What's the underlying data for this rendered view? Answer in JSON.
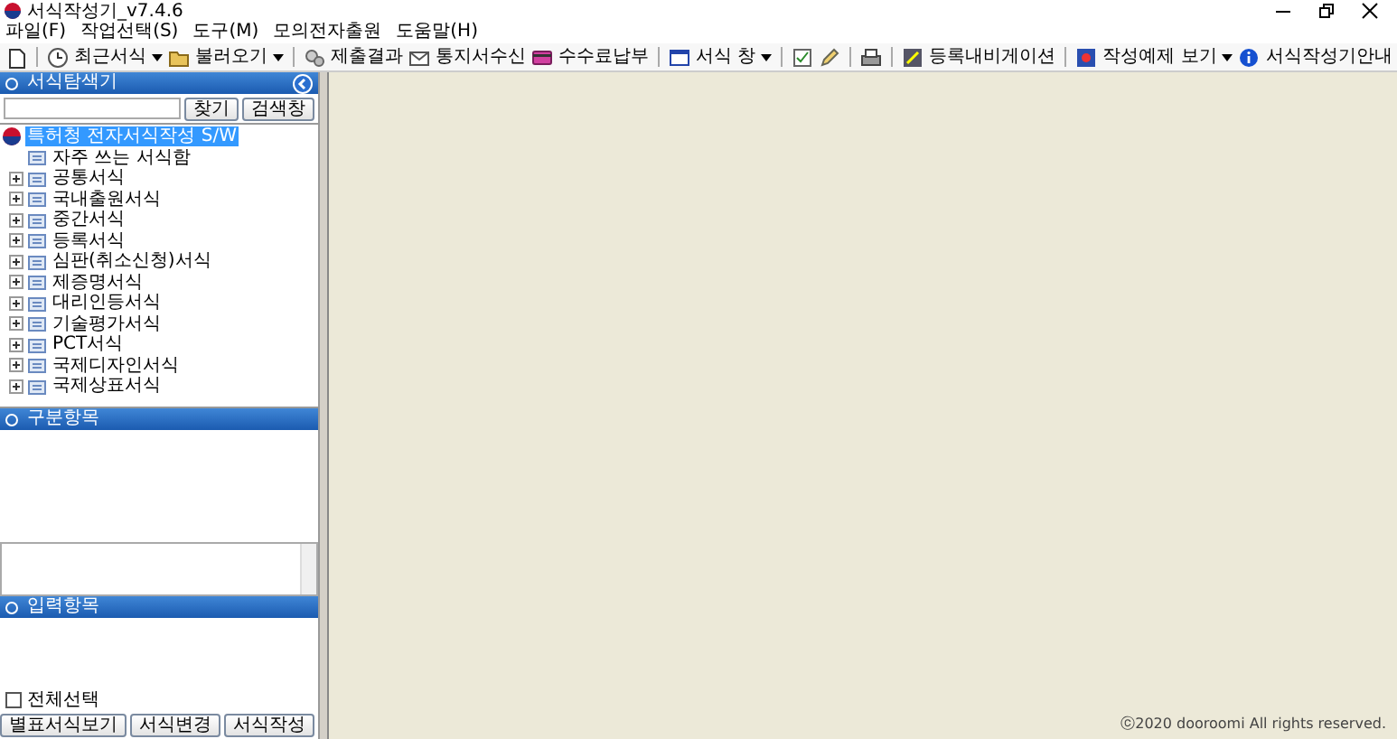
{
  "window": {
    "title": "서식작성기_v7.4.6"
  },
  "menu": [
    "파일(F)",
    "작업선택(S)",
    "도구(M)",
    "모의전자출원",
    "도움말(H)"
  ],
  "toolbar": [
    [
      {
        "kind": "icon"
      }
    ],
    [
      {
        "kind": "button",
        "label": "최근서식",
        "dropdown": true
      },
      {
        "kind": "button",
        "label": "불러오기",
        "dropdown": true
      }
    ],
    [
      {
        "kind": "button",
        "label": "제출결과",
        "dropdown": false
      },
      {
        "kind": "button",
        "label": "통지서수신",
        "dropdown": false
      },
      {
        "kind": "button",
        "label": "수수료납부",
        "dropdown": false
      }
    ],
    [
      {
        "kind": "button",
        "label": "서식 창",
        "dropdown": true
      }
    ],
    [
      {
        "kind": "icon"
      },
      {
        "kind": "icon"
      }
    ],
    [
      {
        "kind": "icon"
      }
    ],
    [
      {
        "kind": "button",
        "label": "등록내비게이션",
        "dropdown": false
      }
    ],
    [
      {
        "kind": "button",
        "label": "작성예제 보기",
        "dropdown": true
      },
      {
        "kind": "button",
        "label": "서식작성기안내",
        "dropdown": false
      }
    ]
  ],
  "explorer": {
    "title": "서식탐색기",
    "find_button": "찾기",
    "search_button": "검색창",
    "tree": [
      {
        "label": "특허청 전자서식작성 S/W",
        "selected": true,
        "children": [
          {
            "label": "자주 쓰는 서식함",
            "selected": false
          },
          {
            "label": "공통서식",
            "selected": false,
            "expanded": false
          },
          {
            "label": "국내출원서식",
            "selected": false,
            "expanded": false
          },
          {
            "label": "중간서식",
            "selected": false,
            "expanded": false
          },
          {
            "label": "등록서식",
            "selected": false,
            "expanded": false
          },
          {
            "label": "심판(취소신청)서식",
            "selected": false,
            "expanded": false
          },
          {
            "label": "제증명서식",
            "selected": false,
            "expanded": false
          },
          {
            "label": "대리인등서식",
            "selected": false,
            "expanded": false
          },
          {
            "label": "기술평가서식",
            "selected": false,
            "expanded": false
          },
          {
            "label": "PCT서식",
            "selected": false,
            "expanded": false
          },
          {
            "label": "국제디자인서식",
            "selected": false,
            "expanded": false
          },
          {
            "label": "국제상표서식",
            "selected": false,
            "expanded": false
          }
        ]
      }
    ]
  },
  "category_panel": {
    "title": "구분항목"
  },
  "input_panel": {
    "title": "입력항목"
  },
  "select_all": {
    "label": "전체선택",
    "checked": false
  },
  "buttons": [
    "별표서식보기",
    "서식변경",
    "서식작성"
  ],
  "footer": "ⓒ2020 dooroomi All rights reserved."
}
